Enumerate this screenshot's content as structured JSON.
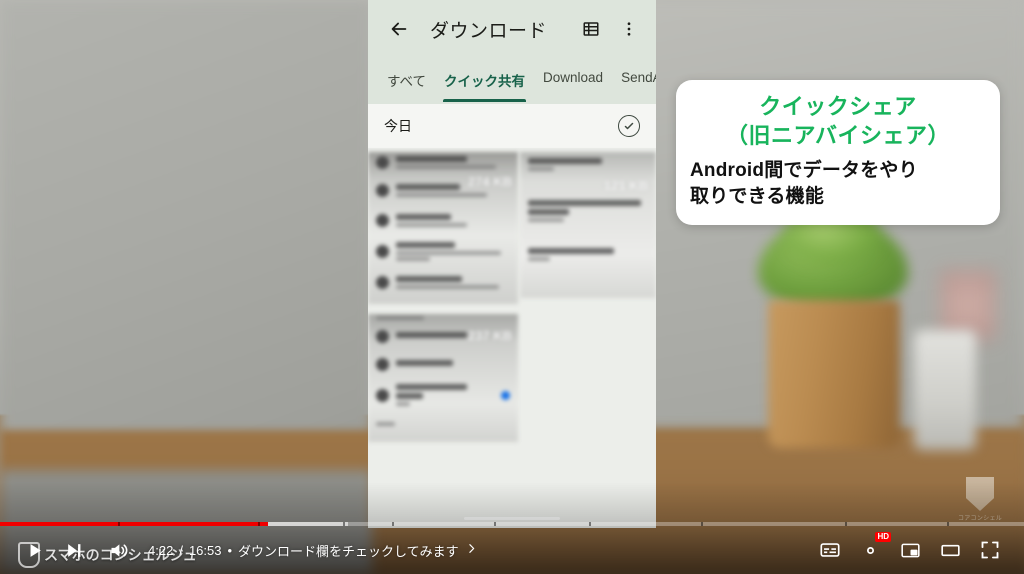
{
  "callout": {
    "heading_line1": "クイックシェア",
    "heading_line2": "（旧ニアバイシェア）",
    "body_line1": "Android間でデータをやり",
    "body_line2": "取りできる機能",
    "heading_color": "#18b45c"
  },
  "phone": {
    "appbar": {
      "back_icon": "arrow-left-icon",
      "title": "ダウンロード",
      "list_icon": "list-view-icon",
      "overflow_icon": "more-vertical-icon",
      "background_color": "#dde5dc"
    },
    "tabs": [
      {
        "label": "すべて",
        "active": false
      },
      {
        "label": "クイック共有",
        "active": true
      },
      {
        "label": "Download",
        "active": false
      },
      {
        "label": "SendA",
        "active": false
      }
    ],
    "active_tab_color": "#18624a",
    "section": {
      "label": "今日",
      "select_icon": "check-circle-icon"
    },
    "file_items": [
      {
        "name": "壁紙とスタイル",
        "subtitle": "色、テーマアイコン、アプリグリッド",
        "size": "274 KB"
      },
      {
        "name": "ユーザー補助",
        "subtitle": "ディスプレイ、操作、音声",
        "size": ""
      },
      {
        "name": "セキュリティ",
        "subtitle": "画面ロック、デバイスを探す、アプリのセキュリティ",
        "size": ""
      },
      {
        "name": "プライバシー",
        "subtitle": "権限、アカウント アクティビティ、個人データ",
        "size": ""
      },
      {
        "name": "長押しする時間",
        "subtitle": "短い",
        "size": "121 KB"
      },
      {
        "name": "操作までの時間（ユーザー補助タイムアウト）",
        "subtitle": "デフォルト",
        "size": ""
      },
      {
        "name": "自動クリック（静止時間）",
        "subtitle": "OFF",
        "size": ""
      },
      {
        "name": "タイミングの管理",
        "subtitle": "",
        "size": "237 KB"
      },
      {
        "name": "システム操作",
        "subtitle": "",
        "size": ""
      },
      {
        "name": "バイブレーションとハプティクス",
        "subtitle": "ON",
        "size": ""
      },
      {
        "name": "自動字幕起こし",
        "subtitle": "メディアの自動字幕起こし",
        "size": ""
      }
    ]
  },
  "player": {
    "play_icon": "play-icon",
    "next_icon": "next-track-icon",
    "volume_icon": "volume-icon",
    "current_time": "4:22",
    "total_time": "16:53",
    "separator": "•",
    "chapter_title": "ダウンロード欄をチェックしてみます",
    "chapter_chevron": "chevron-right-icon",
    "subtitles_icon": "subtitles-icon",
    "settings_icon": "gear-icon",
    "quality_badge": "HD",
    "miniplayer_icon": "miniplayer-icon",
    "theater_icon": "theater-mode-icon",
    "fullscreen_icon": "fullscreen-icon",
    "progress_percent": 26.2,
    "buffered_percent": 34,
    "progress_color": "#f00000"
  },
  "watermark": {
    "channel_name": "スマホのコンシェルジュ",
    "logo_icon": "shield-logo-icon",
    "corner_label": "コアコンシェル"
  }
}
